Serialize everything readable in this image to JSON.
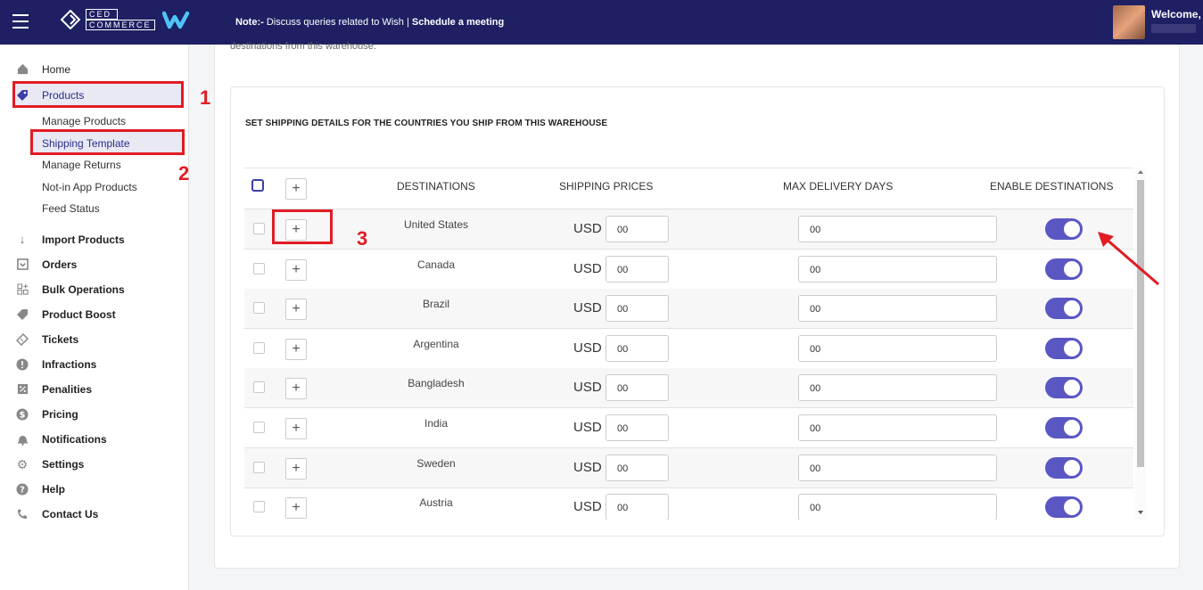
{
  "header": {
    "note_prefix": "Note:-",
    "note_text": " Discuss queries related to Wish | ",
    "note_link": "Schedule a meeting",
    "welcome": "Welcome,",
    "logo_text_top": "CED",
    "logo_text_bottom": "COMMERCE"
  },
  "sidebar": {
    "home": "Home",
    "products": "Products",
    "sub": [
      "Manage Products",
      "Shipping Template",
      "Manage Returns",
      "Not-in App Products",
      "Feed Status"
    ],
    "items": [
      "Import Products",
      "Orders",
      "Bulk Operations",
      "Product Boost",
      "Tickets",
      "Infractions",
      "Penalities",
      "Pricing",
      "Notifications",
      "Settings",
      "Help",
      "Contact Us"
    ]
  },
  "annotations": [
    "1",
    "2",
    "3"
  ],
  "main": {
    "cut_text": "destinations from this warehouse.",
    "section_title": "SET SHIPPING DETAILS FOR THE COUNTRIES YOU SHIP FROM THIS WAREHOUSE",
    "columns": [
      "DESTINATIONS",
      "SHIPPING PRICES",
      "MAX DELIVERY DAYS",
      "ENABLE DESTINATIONS"
    ],
    "currency": "USD",
    "rows": [
      {
        "country": "United States",
        "price": "00",
        "days": "00",
        "enabled": true
      },
      {
        "country": "Canada",
        "price": "00",
        "days": "00",
        "enabled": true
      },
      {
        "country": "Brazil",
        "price": "00",
        "days": "00",
        "enabled": true
      },
      {
        "country": "Argentina",
        "price": "00",
        "days": "00",
        "enabled": true
      },
      {
        "country": "Bangladesh",
        "price": "00",
        "days": "00",
        "enabled": true
      },
      {
        "country": "India",
        "price": "00",
        "days": "00",
        "enabled": true
      },
      {
        "country": "Sweden",
        "price": "00",
        "days": "00",
        "enabled": true
      },
      {
        "country": "Austria",
        "price": "00",
        "days": "00",
        "enabled": true
      }
    ]
  }
}
